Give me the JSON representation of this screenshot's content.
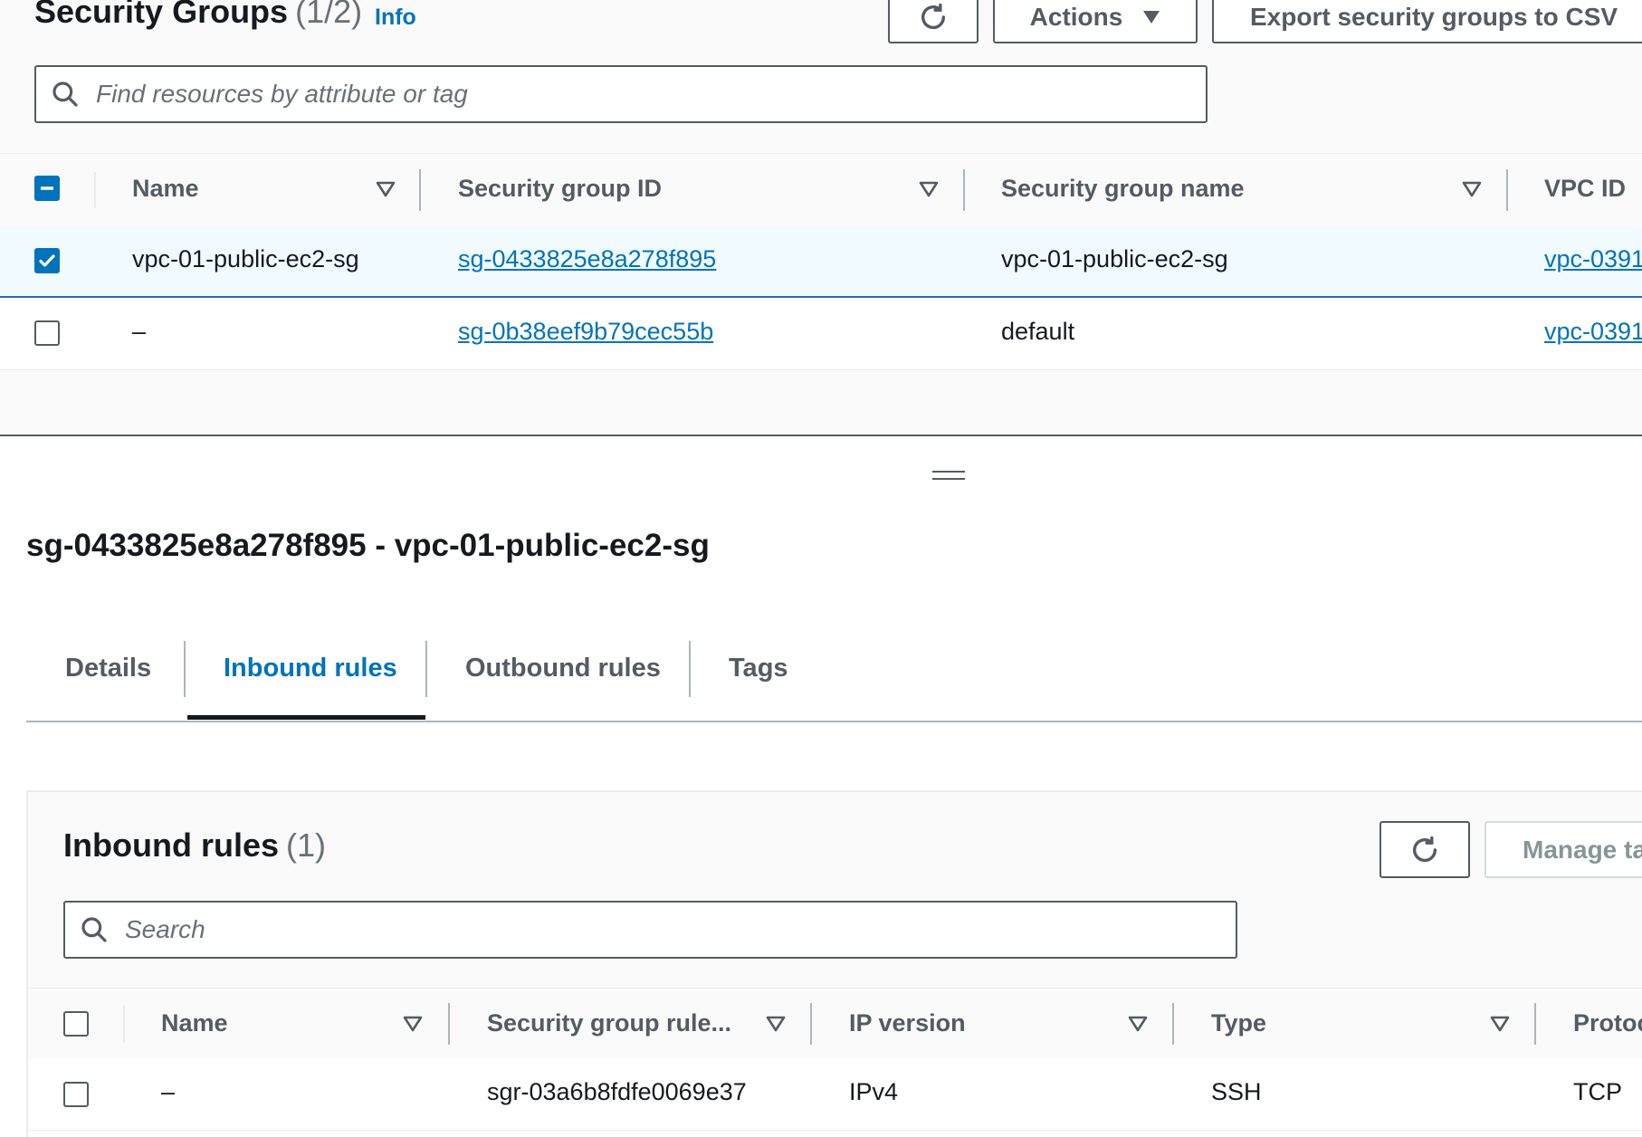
{
  "header": {
    "title": "Security Groups",
    "count": "(1/2)",
    "info": "Info",
    "actions_label": "Actions",
    "export_label": "Export security groups to CSV"
  },
  "search": {
    "placeholder": "Find resources by attribute or tag"
  },
  "sg_table": {
    "columns": [
      "Name",
      "Security group ID",
      "Security group name",
      "VPC ID"
    ],
    "rows": [
      {
        "selected": true,
        "name": "vpc-01-public-ec2-sg",
        "sg_id": "sg-0433825e8a278f895",
        "sg_name": "vpc-01-public-ec2-sg",
        "vpc_id": "vpc-0391"
      },
      {
        "selected": false,
        "name": "–",
        "sg_id": "sg-0b38eef9b79cec55b",
        "sg_name": "default",
        "vpc_id": "vpc-0391"
      }
    ]
  },
  "details": {
    "title": "sg-0433825e8a278f895 - vpc-01-public-ec2-sg",
    "tabs": [
      "Details",
      "Inbound rules",
      "Outbound rules",
      "Tags"
    ],
    "active_tab": "Inbound rules"
  },
  "inbound": {
    "title": "Inbound rules",
    "count": "(1)",
    "manage_label": "Manage ta",
    "search_placeholder": "Search",
    "columns": [
      "Name",
      "Security group rule...",
      "IP version",
      "Type",
      "Protoc"
    ],
    "rows": [
      {
        "name": "–",
        "rule_id": "sgr-03a6b8fdfe0069e37",
        "ip_version": "IPv4",
        "type": "SSH",
        "protocol": "TCP"
      }
    ]
  },
  "colors": {
    "accent": "#0073bb",
    "selected_row_bg": "#f1faff",
    "border_dark": "#545b64"
  }
}
